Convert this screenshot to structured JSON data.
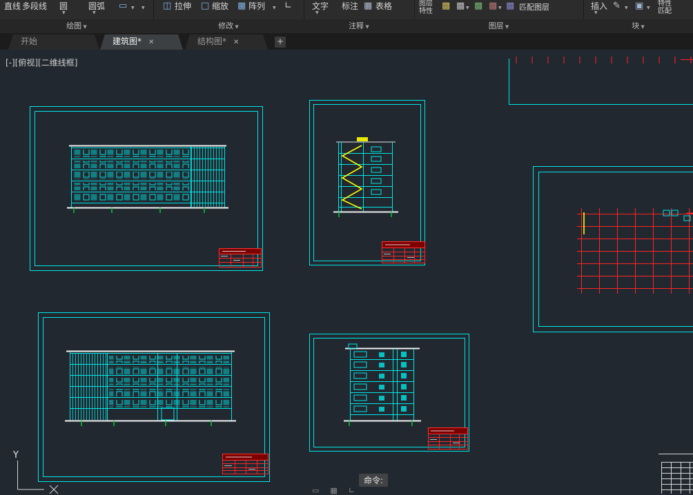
{
  "ribbon": {
    "panels": [
      {
        "label": "绘图",
        "buttons": {
          "line": "直线",
          "polyline": "多段线",
          "circle": "圆",
          "arc": "圆弧"
        }
      },
      {
        "label": "修改",
        "buttons": {
          "stretch": "拉伸",
          "scale": "缩放",
          "array": "阵列"
        }
      },
      {
        "label": "注释",
        "buttons": {
          "text": "文字",
          "dimension": "标注",
          "table": "表格"
        }
      },
      {
        "label": "图层",
        "buttons": {
          "layer_properties": "图层特性",
          "match_layer": "匹配图层"
        }
      },
      {
        "label": "块",
        "buttons": {
          "insert": "插入",
          "match_properties": "特性匹配"
        }
      }
    ]
  },
  "file_tabs": {
    "items": [
      {
        "label": "开始",
        "active": false
      },
      {
        "label": "建筑图*",
        "active": true
      },
      {
        "label": "结构图*",
        "active": false
      }
    ],
    "new_tab_icon": "+",
    "close_icon": "✕"
  },
  "viewport_controls": {
    "label": "[-][俯视][二维线框]"
  },
  "command_line": {
    "prompt": "命令:"
  },
  "ucs_icon": {
    "y_label": "Y"
  },
  "status_bar": {
    "icons": [
      "▭",
      "▦",
      "∟"
    ]
  },
  "colors": {
    "canvas_bg": "#212830",
    "frame_cyan": "#00e8e8",
    "grid_red": "#ff2424",
    "stair_yellow": "#ffff00",
    "tick_green": "#00cc33",
    "title_block_red": "#7d0000"
  }
}
